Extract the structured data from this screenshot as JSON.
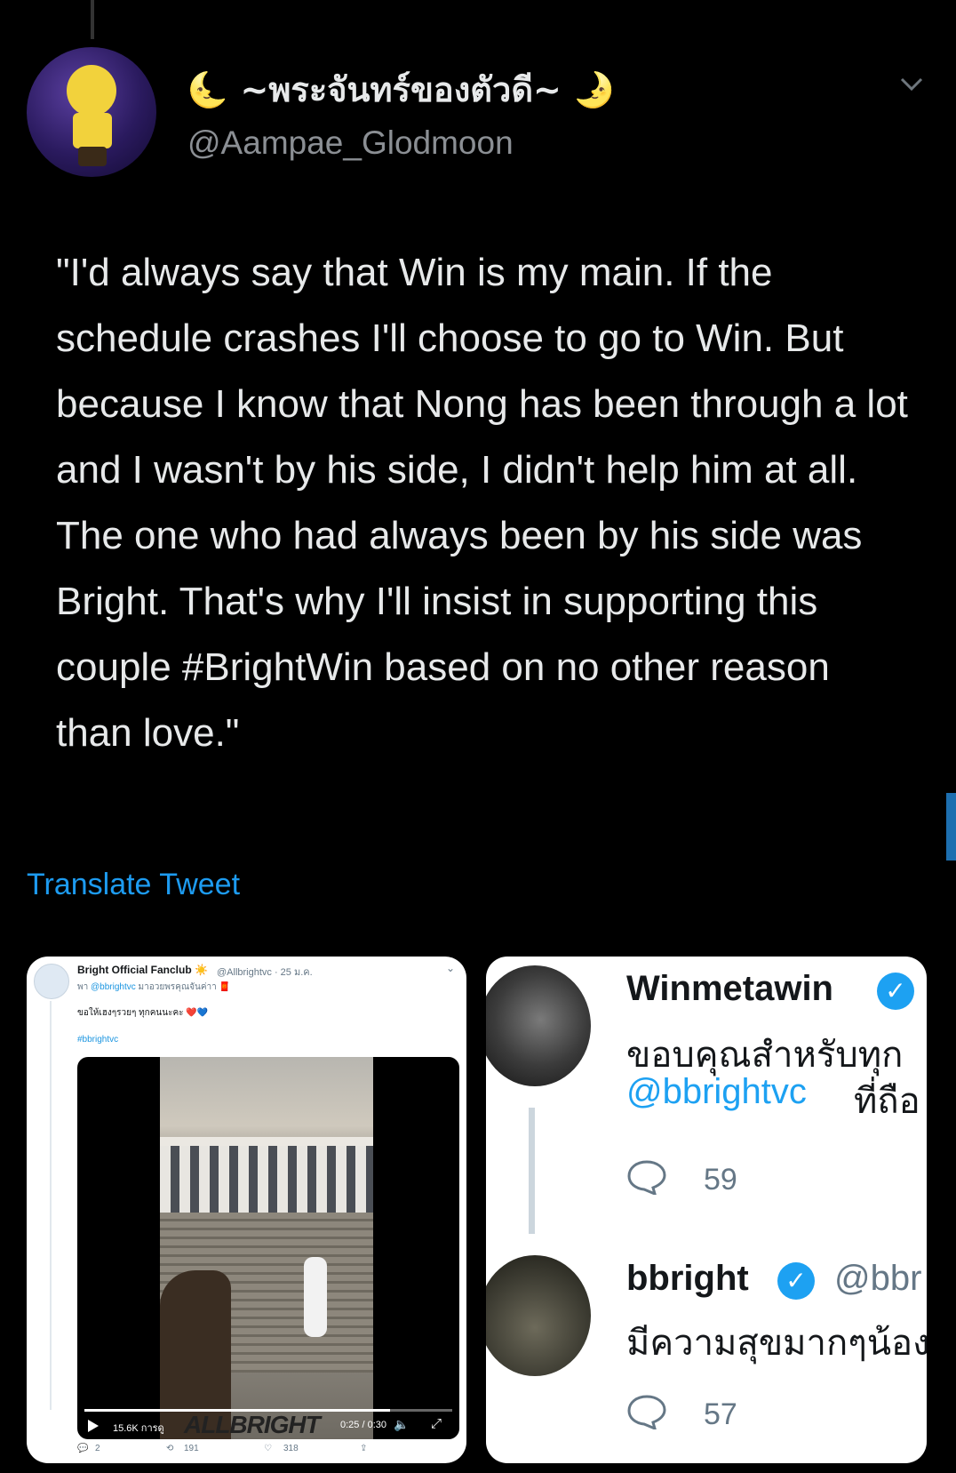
{
  "tweet": {
    "display_name": "🌜 ~พระจันทร์ของตัวดี~ 🌛",
    "handle": "@Aampae_Glodmoon",
    "text": "\"I'd always say that Win is my main. If the schedule crashes I'll choose to go to Win. But because I know that Nong has been through a lot and I wasn't by his side, I didn't help him at all. The one who had always been by his side was Bright. That's why I'll insist in supporting this couple #BrightWin based on no other reason than love.\"",
    "translate_label": "Translate Tweet"
  },
  "media_left": {
    "name": "Bright Official Fanclub ☀️",
    "handle": "@Allbrightvc · 25 ม.ค.",
    "reply_prefix": "พา",
    "reply_mention": "@bbrightvc",
    "reply_suffix": "มาอวยพรคุณจันค่าา 🧧",
    "text": "ขอให้เฮงๆรวยๆ ทุกคนนะคะ ❤️💙",
    "hashtag": "#bbrightvc",
    "watermark": "ALLBRIGHT",
    "views": "15.6K การดู",
    "time": "0:25 / 0:30",
    "video_progress": 0.83,
    "replies": "2",
    "retweets": "191",
    "likes": "318"
  },
  "media_right": {
    "tweet1": {
      "name": "Winmetawin",
      "text": "ขอบคุณสำหรับทุก",
      "mention": "@bbrightvc",
      "mention_tail": "ที่ถือ",
      "reply_count": "59"
    },
    "tweet2": {
      "name": "bbright",
      "handle": "@bbr",
      "text": "มีความสุขมากๆน้อง",
      "reply_count": "57"
    }
  },
  "colors": {
    "background": "#000000",
    "text": "#e7e9ea",
    "link": "#1d9bf0",
    "handle": "#8b8f94"
  },
  "icons": [
    "chevron-down-icon",
    "verified-badge-icon",
    "reply-icon",
    "retweet-icon",
    "like-icon",
    "share-icon",
    "play-icon",
    "volume-icon",
    "fullscreen-icon"
  ]
}
